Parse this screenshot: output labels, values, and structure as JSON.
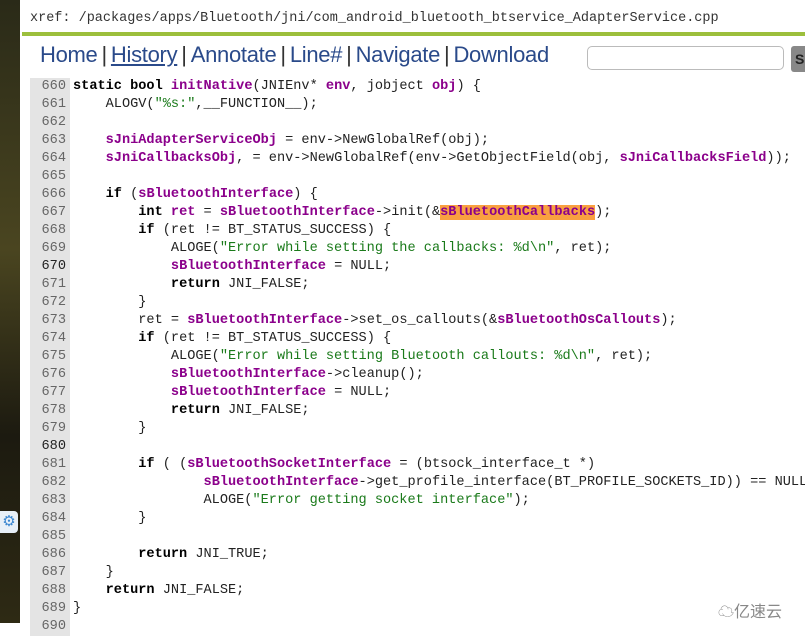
{
  "xref": "xref: /packages/apps/Bluetooth/jni/com_android_bluetooth_btservice_AdapterService.cpp",
  "nav": [
    "Home",
    "History",
    "Annotate",
    "Line#",
    "Navigate",
    "Download"
  ],
  "search": {
    "placeholder": "",
    "value": ""
  },
  "go_label": "S",
  "watermark": "亿速云",
  "code": [
    {
      "n": "660",
      "t": [
        [
          "kw",
          "static bool "
        ],
        [
          "fn",
          "initNative"
        ],
        [
          "",
          "(JNIEnv* "
        ],
        [
          "var",
          "env"
        ],
        [
          "",
          ", jobject "
        ],
        [
          "var",
          "obj"
        ],
        [
          "",
          ") {"
        ]
      ]
    },
    {
      "n": "661",
      "t": [
        [
          "",
          "    ALOGV("
        ],
        [
          "str",
          "\"%s:\""
        ],
        [
          "",
          ",__FUNCTION__);"
        ]
      ]
    },
    {
      "n": "662",
      "t": []
    },
    {
      "n": "663",
      "t": [
        [
          "",
          "    "
        ],
        [
          "var",
          "sJniAdapterServiceObj"
        ],
        [
          "",
          " = env->NewGlobalRef(obj);"
        ]
      ]
    },
    {
      "n": "664",
      "t": [
        [
          "",
          "    "
        ],
        [
          "var",
          "sJniCallbacksObj"
        ],
        [
          "",
          ", = env->NewGlobalRef(env->GetObjectField(obj, "
        ],
        [
          "var",
          "sJniCallbacksField"
        ],
        [
          "",
          "));"
        ]
      ]
    },
    {
      "n": "665",
      "t": []
    },
    {
      "n": "666",
      "t": [
        [
          "",
          "    "
        ],
        [
          "kw",
          "if"
        ],
        [
          "",
          " ("
        ],
        [
          "var",
          "sBluetoothInterface"
        ],
        [
          "",
          ") {"
        ]
      ]
    },
    {
      "n": "667",
      "t": [
        [
          "",
          "        "
        ],
        [
          "kw",
          "int "
        ],
        [
          "var",
          "ret"
        ],
        [
          "",
          " = "
        ],
        [
          "var",
          "sBluetoothInterface"
        ],
        [
          "",
          "->init(&"
        ],
        [
          "hl",
          "sBluetoothCallbacks"
        ],
        [
          "",
          ");"
        ]
      ]
    },
    {
      "n": "668",
      "t": [
        [
          "",
          "        "
        ],
        [
          "kw",
          "if"
        ],
        [
          "",
          " (ret != BT_STATUS_SUCCESS) {"
        ]
      ]
    },
    {
      "n": "669",
      "t": [
        [
          "",
          "            ALOGE("
        ],
        [
          "str",
          "\"Error while setting the callbacks: %d\\n\""
        ],
        [
          "",
          ", ret);"
        ]
      ]
    },
    {
      "n": "670",
      "d": true,
      "t": [
        [
          "",
          "            "
        ],
        [
          "var",
          "sBluetoothInterface"
        ],
        [
          "",
          " = NULL;"
        ]
      ]
    },
    {
      "n": "671",
      "t": [
        [
          "",
          "            "
        ],
        [
          "kw",
          "return"
        ],
        [
          "",
          " JNI_FALSE;"
        ]
      ]
    },
    {
      "n": "672",
      "t": [
        [
          "",
          "        }"
        ]
      ]
    },
    {
      "n": "673",
      "t": [
        [
          "",
          "        ret = "
        ],
        [
          "var",
          "sBluetoothInterface"
        ],
        [
          "",
          "->set_os_callouts(&"
        ],
        [
          "var",
          "sBluetoothOsCallouts"
        ],
        [
          "",
          ");"
        ]
      ]
    },
    {
      "n": "674",
      "t": [
        [
          "",
          "        "
        ],
        [
          "kw",
          "if"
        ],
        [
          "",
          " (ret != BT_STATUS_SUCCESS) {"
        ]
      ]
    },
    {
      "n": "675",
      "t": [
        [
          "",
          "            ALOGE("
        ],
        [
          "str",
          "\"Error while setting Bluetooth callouts: %d\\n\""
        ],
        [
          "",
          ", ret);"
        ]
      ]
    },
    {
      "n": "676",
      "t": [
        [
          "",
          "            "
        ],
        [
          "var",
          "sBluetoothInterface"
        ],
        [
          "",
          "->cleanup();"
        ]
      ]
    },
    {
      "n": "677",
      "t": [
        [
          "",
          "            "
        ],
        [
          "var",
          "sBluetoothInterface"
        ],
        [
          "",
          " = NULL;"
        ]
      ]
    },
    {
      "n": "678",
      "t": [
        [
          "",
          "            "
        ],
        [
          "kw",
          "return"
        ],
        [
          "",
          " JNI_FALSE;"
        ]
      ]
    },
    {
      "n": "679",
      "t": [
        [
          "",
          "        }"
        ]
      ]
    },
    {
      "n": "680",
      "d": true,
      "t": []
    },
    {
      "n": "681",
      "t": [
        [
          "",
          "        "
        ],
        [
          "kw",
          "if"
        ],
        [
          "",
          " ( ("
        ],
        [
          "var",
          "sBluetoothSocketInterface"
        ],
        [
          "",
          " = (btsock_interface_t *)"
        ]
      ]
    },
    {
      "n": "682",
      "t": [
        [
          "",
          "                "
        ],
        [
          "var",
          "sBluetoothInterface"
        ],
        [
          "",
          "->get_profile_interface(BT_PROFILE_SOCKETS_ID)) == NULL) {"
        ]
      ]
    },
    {
      "n": "683",
      "t": [
        [
          "",
          "                ALOGE("
        ],
        [
          "str",
          "\"Error getting socket interface\""
        ],
        [
          "",
          ");"
        ]
      ]
    },
    {
      "n": "684",
      "t": [
        [
          "",
          "        }"
        ]
      ]
    },
    {
      "n": "685",
      "t": []
    },
    {
      "n": "686",
      "t": [
        [
          "",
          "        "
        ],
        [
          "kw",
          "return"
        ],
        [
          "",
          " JNI_TRUE;"
        ]
      ]
    },
    {
      "n": "687",
      "t": [
        [
          "",
          "    }"
        ]
      ]
    },
    {
      "n": "688",
      "t": [
        [
          "",
          "    "
        ],
        [
          "kw",
          "return"
        ],
        [
          "",
          " JNI_FALSE;"
        ]
      ]
    },
    {
      "n": "689",
      "t": [
        [
          "",
          "}"
        ]
      ]
    },
    {
      "n": "690",
      "t": []
    }
  ]
}
